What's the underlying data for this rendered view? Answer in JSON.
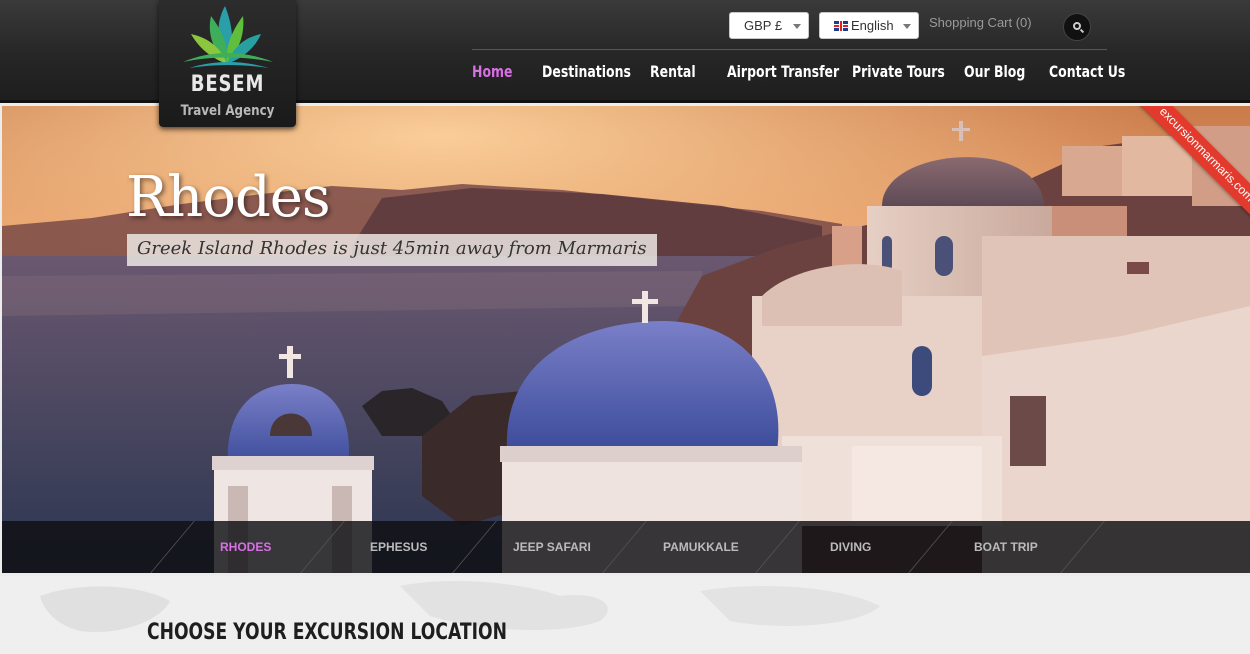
{
  "logo": {
    "name": "BESEM",
    "subtitle": "Travel Agency"
  },
  "topbar": {
    "currency": "GBP £",
    "language": "English",
    "cart": "Shopping Cart (0)"
  },
  "nav": {
    "items": [
      {
        "label": "Home",
        "active": true
      },
      {
        "label": "Destinations",
        "active": false
      },
      {
        "label": "Rental",
        "active": false
      },
      {
        "label": "Airport Transfer",
        "active": false
      },
      {
        "label": "Private Tours",
        "active": false
      },
      {
        "label": "Our Blog",
        "active": false
      },
      {
        "label": "Contact Us",
        "active": false
      }
    ]
  },
  "hero": {
    "title": "Rhodes",
    "subtitle": "Greek Island Rhodes is just 45min away from Marmaris",
    "ribbon": "excursionmarmaris.com"
  },
  "tabs": [
    {
      "label": "RHODES",
      "active": true
    },
    {
      "label": "EPHESUS",
      "active": false
    },
    {
      "label": "JEEP SAFARI",
      "active": false
    },
    {
      "label": "PAMUKKALE",
      "active": false
    },
    {
      "label": "DIVING",
      "active": false
    },
    {
      "label": "BOAT TRIP",
      "active": false
    }
  ],
  "section": {
    "title": "CHOOSE YOUR EXCURSION LOCATION"
  },
  "colors": {
    "accent": "#d86fe6",
    "ribbon": "#e23a2c",
    "header": "#262626"
  }
}
